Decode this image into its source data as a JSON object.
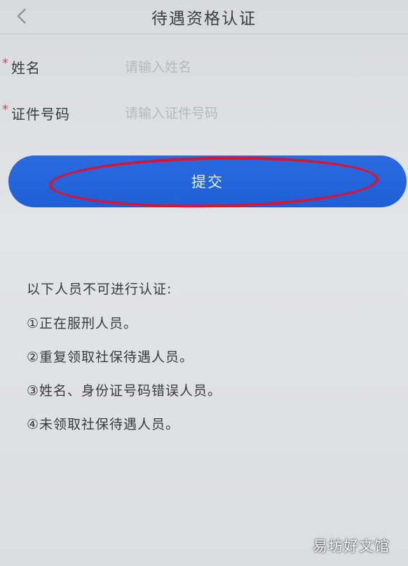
{
  "header": {
    "back_icon": "chevron-left-icon",
    "title": "待遇资格认证"
  },
  "form": {
    "name": {
      "required_mark": "*",
      "label": "姓名",
      "placeholder": "请输入姓名",
      "value": ""
    },
    "id_number": {
      "required_mark": "*",
      "label": "证件号码",
      "placeholder": "请输入证件号码",
      "value": ""
    }
  },
  "submit": {
    "label": "提交"
  },
  "notice": {
    "title": "以下人员不可进行认证:",
    "items": [
      "①正在服刑人员。",
      "②重复领取社保待遇人员。",
      "③姓名、身份证号码错误人员。",
      "④未领取社保待遇人员。"
    ]
  },
  "watermark": "易坊好文馆",
  "colors": {
    "primary": "#1f5fd6",
    "required": "#d84a4a",
    "annotation": "#e2102a",
    "background": "#e0e1e5"
  }
}
